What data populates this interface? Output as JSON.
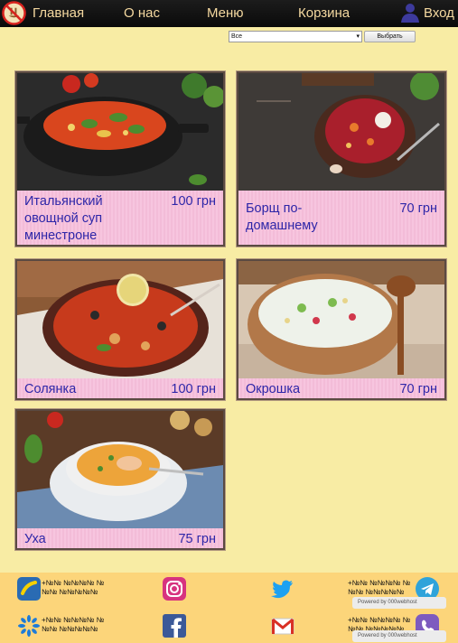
{
  "header": {
    "nav": [
      "Главная",
      "О нас",
      "Меню",
      "Корзина"
    ],
    "login": "Вход"
  },
  "filter": {
    "selected": "Все",
    "button": "Выбрать"
  },
  "dishes": [
    {
      "name": "Итальянский овощной суп минестроне",
      "price": "100 грн"
    },
    {
      "name": "Борщ по-домашнему",
      "price": "70 грн"
    },
    {
      "name": "Солянка",
      "price": "100 грн"
    },
    {
      "name": "Окрошка",
      "price": "70 грн"
    },
    {
      "name": "Уха",
      "price": "75 грн"
    }
  ],
  "footer": {
    "contacts": [
      "+№№ №№№№ № №№ №№№№№",
      "+№№ №№№№ № №№ №№№№№",
      "+№№ №№№№ № №№ №№№№№",
      "+№№ №№№№ № №№ №№№№№"
    ],
    "badge": "Powered by 000webhost"
  },
  "colors": {
    "page_bg": "#f8eca4",
    "card_bg": "#f6c2dd",
    "card_text": "#2e26a8",
    "nav_text": "#f5d9a0",
    "footer_bg": "#fcd57a"
  },
  "icons": [
    "no-food-logo-icon",
    "user-icon",
    "lifecell-icon",
    "instagram-icon",
    "twitter-icon",
    "telegram-icon",
    "kyivstar-icon",
    "facebook-icon",
    "gmail-icon",
    "viber-icon"
  ]
}
